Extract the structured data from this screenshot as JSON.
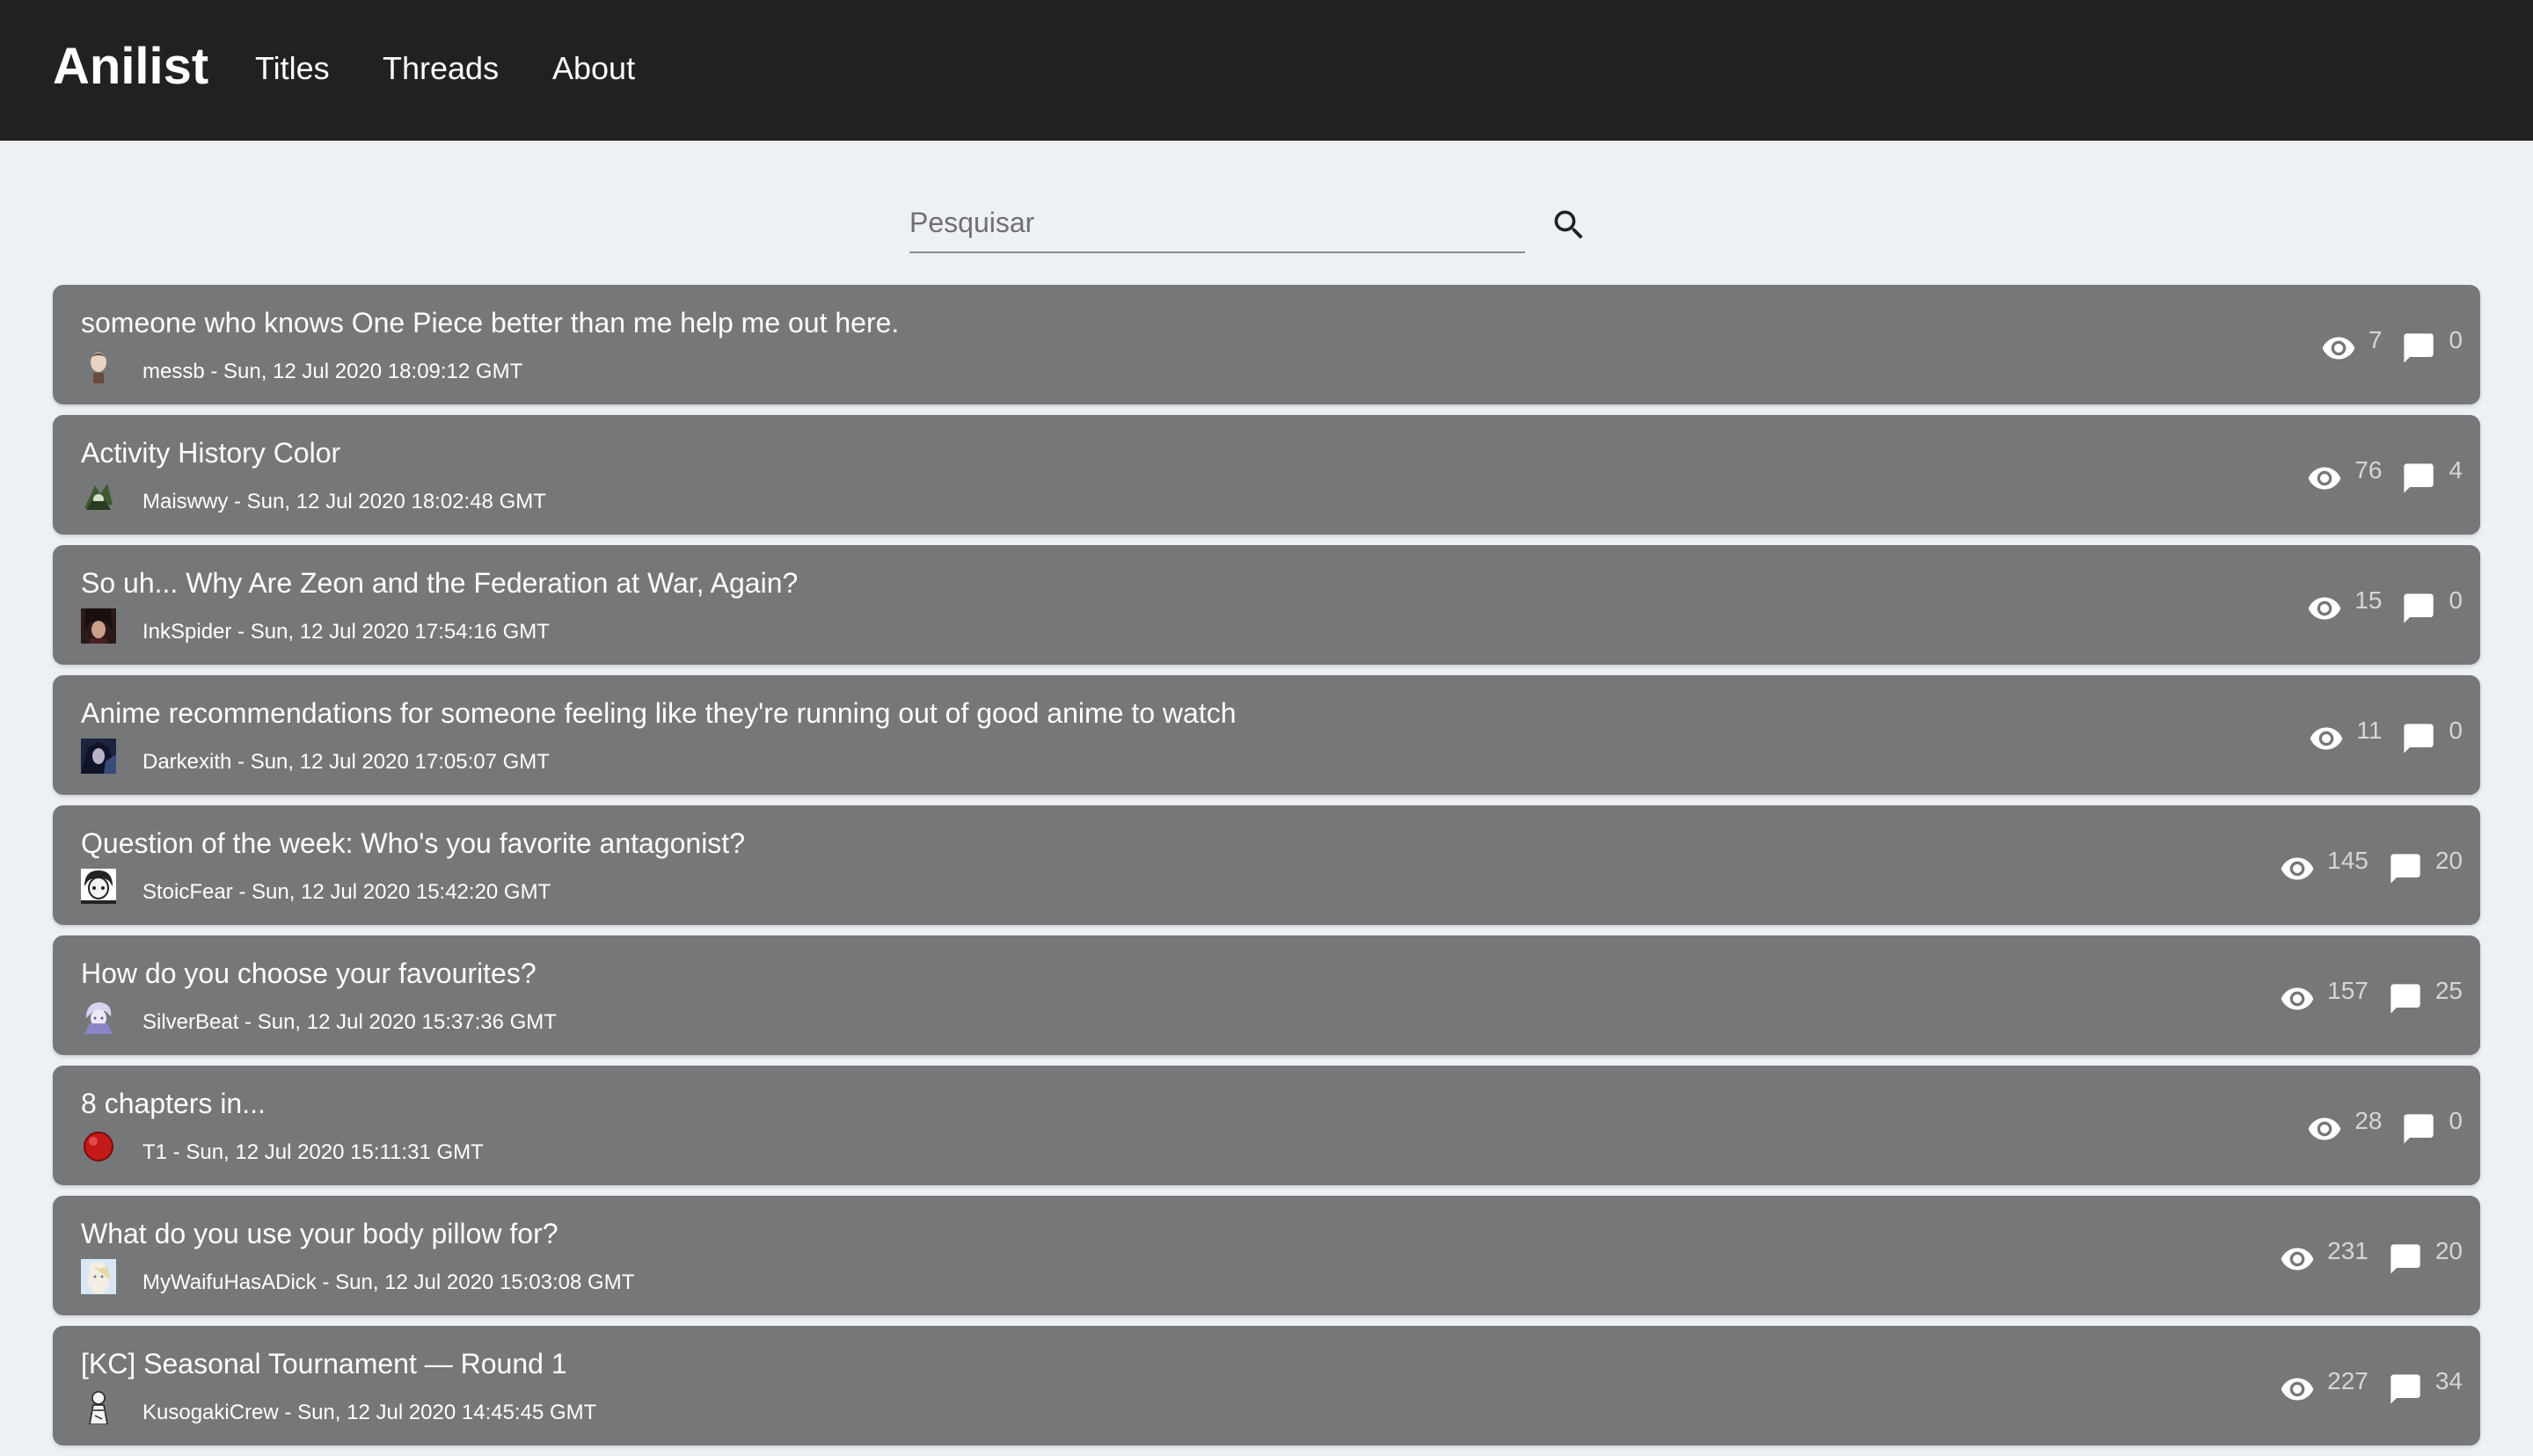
{
  "brand": "Anilist",
  "nav": [
    "Titles",
    "Threads",
    "About"
  ],
  "search": {
    "placeholder": "Pesquisar"
  },
  "threads": [
    {
      "title": "someone who knows One Piece better than me help me out here.",
      "meta": "messb - Sun, 12 Jul 2020 18:09:12 GMT",
      "views": "7",
      "replies": "0"
    },
    {
      "title": "Activity History Color",
      "meta": "Maiswwy - Sun, 12 Jul 2020 18:02:48 GMT",
      "views": "76",
      "replies": "4"
    },
    {
      "title": "So uh... Why Are Zeon and the Federation at War, Again?",
      "meta": "InkSpider - Sun, 12 Jul 2020 17:54:16 GMT",
      "views": "15",
      "replies": "0"
    },
    {
      "title": "Anime recommendations for someone feeling like they're running out of good anime to watch",
      "meta": "Darkexith - Sun, 12 Jul 2020 17:05:07 GMT",
      "views": "11",
      "replies": "0"
    },
    {
      "title": "Question of the week: Who's you favorite antagonist?",
      "meta": "StoicFear - Sun, 12 Jul 2020 15:42:20 GMT",
      "views": "145",
      "replies": "20"
    },
    {
      "title": "How do you choose your favourites?",
      "meta": "SilverBeat - Sun, 12 Jul 2020 15:37:36 GMT",
      "views": "157",
      "replies": "25"
    },
    {
      "title": "8 chapters in...",
      "meta": "T1 - Sun, 12 Jul 2020 15:11:31 GMT",
      "views": "28",
      "replies": "0"
    },
    {
      "title": "What do you use your body pillow for?",
      "meta": "MyWaifuHasADick - Sun, 12 Jul 2020 15:03:08 GMT",
      "views": "231",
      "replies": "20"
    },
    {
      "title": "[KC] Seasonal Tournament — Round 1",
      "meta": "KusogakiCrew - Sun, 12 Jul 2020 14:45:45 GMT",
      "views": "227",
      "replies": "34"
    }
  ]
}
